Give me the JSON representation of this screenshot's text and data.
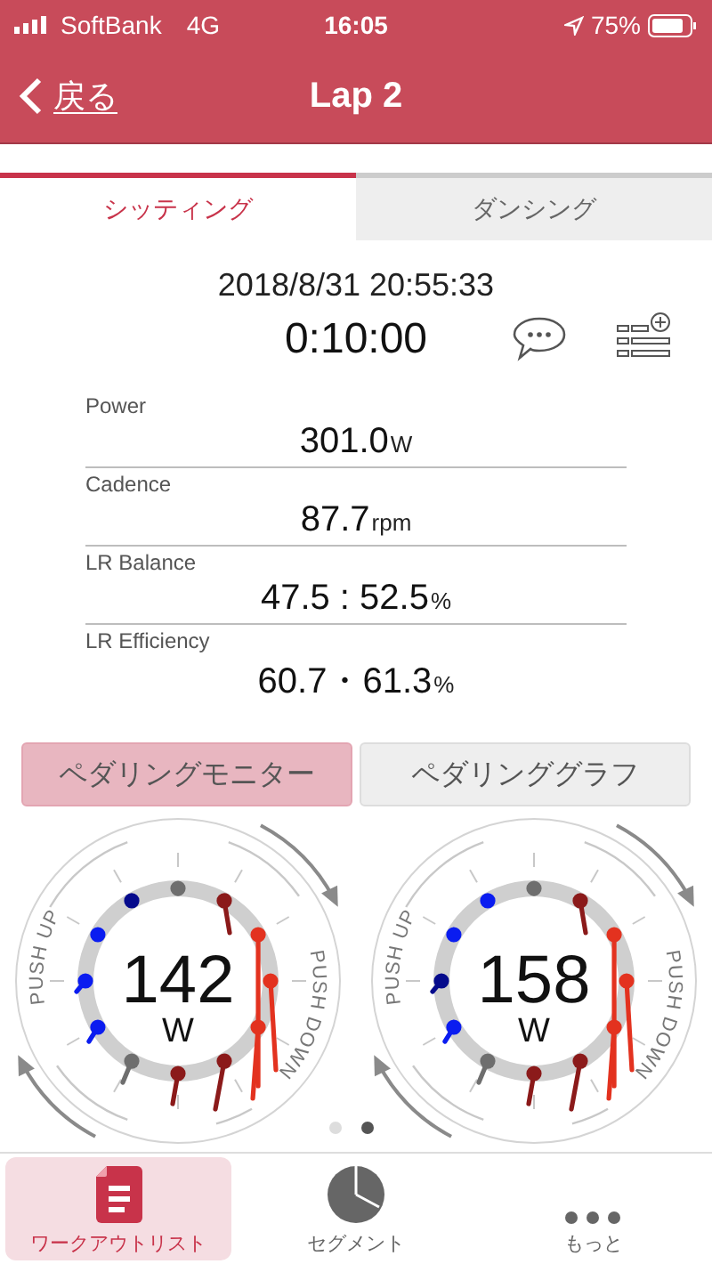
{
  "status_bar": {
    "carrier": "SoftBank",
    "network": "4G",
    "time": "16:05",
    "battery": "75%"
  },
  "nav": {
    "back": "戻る",
    "title": "Lap 2"
  },
  "tabs": [
    {
      "label": "シッティング",
      "selected": true
    },
    {
      "label": "ダンシング",
      "selected": false
    }
  ],
  "summary": {
    "datetime": "2018/8/31 20:55:33",
    "duration": "0:10:00"
  },
  "metrics": [
    {
      "label": "Power",
      "value": "301.0",
      "unit": "W"
    },
    {
      "label": "Cadence",
      "value": "87.7",
      "unit": "rpm"
    },
    {
      "label": "LR Balance",
      "value": "47.5 : 52.5",
      "unit": "%"
    },
    {
      "label": "LR Efficiency",
      "value": "60.7・61.3",
      "unit": "%"
    }
  ],
  "view_toggle": [
    {
      "label": "ペダリングモニター",
      "selected": true
    },
    {
      "label": "ペダリンググラフ",
      "selected": false
    }
  ],
  "dials": [
    {
      "value": "142",
      "unit": "W",
      "push_up": "PUSH UP",
      "push_down": "PUSH DOWN"
    },
    {
      "value": "158",
      "unit": "W",
      "push_up": "PUSH UP",
      "push_down": "PUSH DOWN"
    }
  ],
  "pager": [
    {
      "selected": false
    },
    {
      "selected": true
    }
  ],
  "tab_bar": [
    {
      "label": "ワークアウトリスト",
      "kind": "document",
      "selected": true
    },
    {
      "label": "セグメント",
      "kind": "pie",
      "selected": false
    },
    {
      "label": "もっと",
      "kind": "more",
      "selected": false
    }
  ]
}
